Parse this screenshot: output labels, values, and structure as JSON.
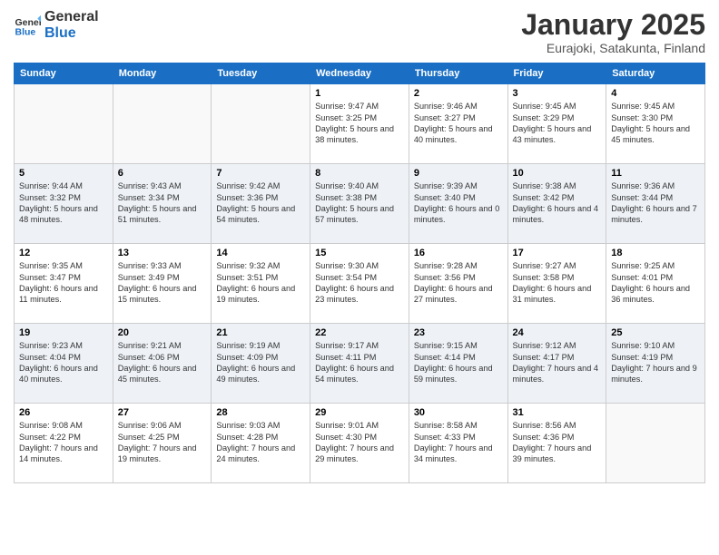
{
  "logo": {
    "line1": "General",
    "line2": "Blue"
  },
  "title": "January 2025",
  "subtitle": "Eurajoki, Satakunta, Finland",
  "headers": [
    "Sunday",
    "Monday",
    "Tuesday",
    "Wednesday",
    "Thursday",
    "Friday",
    "Saturday"
  ],
  "weeks": [
    [
      {
        "day": "",
        "info": ""
      },
      {
        "day": "",
        "info": ""
      },
      {
        "day": "",
        "info": ""
      },
      {
        "day": "1",
        "info": "Sunrise: 9:47 AM\nSunset: 3:25 PM\nDaylight: 5 hours and 38 minutes."
      },
      {
        "day": "2",
        "info": "Sunrise: 9:46 AM\nSunset: 3:27 PM\nDaylight: 5 hours and 40 minutes."
      },
      {
        "day": "3",
        "info": "Sunrise: 9:45 AM\nSunset: 3:29 PM\nDaylight: 5 hours and 43 minutes."
      },
      {
        "day": "4",
        "info": "Sunrise: 9:45 AM\nSunset: 3:30 PM\nDaylight: 5 hours and 45 minutes."
      }
    ],
    [
      {
        "day": "5",
        "info": "Sunrise: 9:44 AM\nSunset: 3:32 PM\nDaylight: 5 hours and 48 minutes."
      },
      {
        "day": "6",
        "info": "Sunrise: 9:43 AM\nSunset: 3:34 PM\nDaylight: 5 hours and 51 minutes."
      },
      {
        "day": "7",
        "info": "Sunrise: 9:42 AM\nSunset: 3:36 PM\nDaylight: 5 hours and 54 minutes."
      },
      {
        "day": "8",
        "info": "Sunrise: 9:40 AM\nSunset: 3:38 PM\nDaylight: 5 hours and 57 minutes."
      },
      {
        "day": "9",
        "info": "Sunrise: 9:39 AM\nSunset: 3:40 PM\nDaylight: 6 hours and 0 minutes."
      },
      {
        "day": "10",
        "info": "Sunrise: 9:38 AM\nSunset: 3:42 PM\nDaylight: 6 hours and 4 minutes."
      },
      {
        "day": "11",
        "info": "Sunrise: 9:36 AM\nSunset: 3:44 PM\nDaylight: 6 hours and 7 minutes."
      }
    ],
    [
      {
        "day": "12",
        "info": "Sunrise: 9:35 AM\nSunset: 3:47 PM\nDaylight: 6 hours and 11 minutes."
      },
      {
        "day": "13",
        "info": "Sunrise: 9:33 AM\nSunset: 3:49 PM\nDaylight: 6 hours and 15 minutes."
      },
      {
        "day": "14",
        "info": "Sunrise: 9:32 AM\nSunset: 3:51 PM\nDaylight: 6 hours and 19 minutes."
      },
      {
        "day": "15",
        "info": "Sunrise: 9:30 AM\nSunset: 3:54 PM\nDaylight: 6 hours and 23 minutes."
      },
      {
        "day": "16",
        "info": "Sunrise: 9:28 AM\nSunset: 3:56 PM\nDaylight: 6 hours and 27 minutes."
      },
      {
        "day": "17",
        "info": "Sunrise: 9:27 AM\nSunset: 3:58 PM\nDaylight: 6 hours and 31 minutes."
      },
      {
        "day": "18",
        "info": "Sunrise: 9:25 AM\nSunset: 4:01 PM\nDaylight: 6 hours and 36 minutes."
      }
    ],
    [
      {
        "day": "19",
        "info": "Sunrise: 9:23 AM\nSunset: 4:04 PM\nDaylight: 6 hours and 40 minutes."
      },
      {
        "day": "20",
        "info": "Sunrise: 9:21 AM\nSunset: 4:06 PM\nDaylight: 6 hours and 45 minutes."
      },
      {
        "day": "21",
        "info": "Sunrise: 9:19 AM\nSunset: 4:09 PM\nDaylight: 6 hours and 49 minutes."
      },
      {
        "day": "22",
        "info": "Sunrise: 9:17 AM\nSunset: 4:11 PM\nDaylight: 6 hours and 54 minutes."
      },
      {
        "day": "23",
        "info": "Sunrise: 9:15 AM\nSunset: 4:14 PM\nDaylight: 6 hours and 59 minutes."
      },
      {
        "day": "24",
        "info": "Sunrise: 9:12 AM\nSunset: 4:17 PM\nDaylight: 7 hours and 4 minutes."
      },
      {
        "day": "25",
        "info": "Sunrise: 9:10 AM\nSunset: 4:19 PM\nDaylight: 7 hours and 9 minutes."
      }
    ],
    [
      {
        "day": "26",
        "info": "Sunrise: 9:08 AM\nSunset: 4:22 PM\nDaylight: 7 hours and 14 minutes."
      },
      {
        "day": "27",
        "info": "Sunrise: 9:06 AM\nSunset: 4:25 PM\nDaylight: 7 hours and 19 minutes."
      },
      {
        "day": "28",
        "info": "Sunrise: 9:03 AM\nSunset: 4:28 PM\nDaylight: 7 hours and 24 minutes."
      },
      {
        "day": "29",
        "info": "Sunrise: 9:01 AM\nSunset: 4:30 PM\nDaylight: 7 hours and 29 minutes."
      },
      {
        "day": "30",
        "info": "Sunrise: 8:58 AM\nSunset: 4:33 PM\nDaylight: 7 hours and 34 minutes."
      },
      {
        "day": "31",
        "info": "Sunrise: 8:56 AM\nSunset: 4:36 PM\nDaylight: 7 hours and 39 minutes."
      },
      {
        "day": "",
        "info": ""
      }
    ]
  ]
}
